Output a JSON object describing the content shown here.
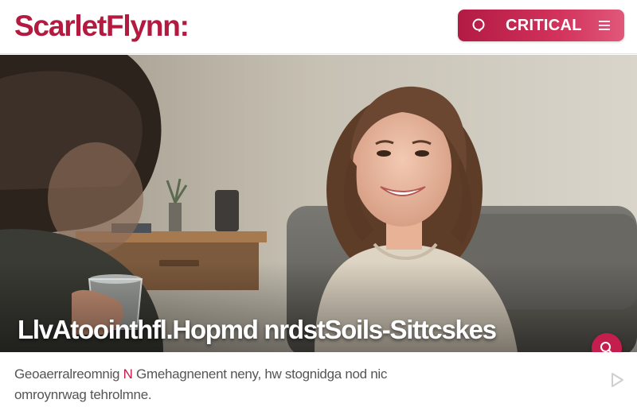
{
  "header": {
    "logo_text": "ScarletFlynn:",
    "pill_label": "CRITICAL",
    "search_icon": "search-icon",
    "menu_icon": "menu-icon"
  },
  "hero": {
    "title": "LlvAtoointhfl.Hopmd nrdstSoils-Sittcskes",
    "fab_icon": "search-icon"
  },
  "caption": {
    "part1": "Geoaerralreomnig ",
    "accent": "N",
    "part2": " Gmehagnenent neny, hw stognidga nod nic",
    "line2": "omroynrwag tehrolmne."
  },
  "colors": {
    "brand": "#c41e4e",
    "logo_text": "#b4193f",
    "caption_text": "#555555"
  }
}
